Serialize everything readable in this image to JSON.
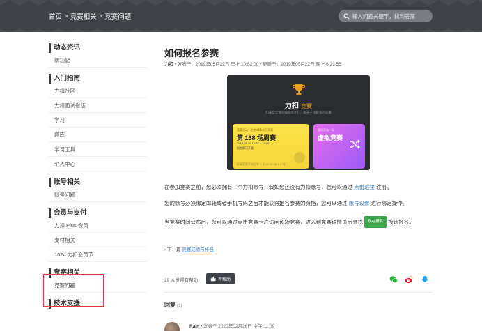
{
  "header": {
    "breadcrumbs": [
      "首页",
      "竞赛相关",
      "竞赛问题"
    ],
    "separator": ">",
    "search_placeholder": "输入问题关键字，找到答案"
  },
  "sidebar": {
    "sections": [
      {
        "title": "动态资讯",
        "items": [
          "新功能"
        ]
      },
      {
        "title": "入门指南",
        "items": [
          "力扣社区",
          "力扣面试省版",
          "学习",
          "题库",
          "学习工具",
          "个人中心"
        ]
      },
      {
        "title": "账号相关",
        "items": [
          "账号问题"
        ]
      },
      {
        "title": "会员与支付",
        "items": [
          "力扣 Plus 会员",
          "支付相关",
          "1024 力扣会员节"
        ]
      },
      {
        "title": "竞赛相关",
        "items": [
          "竞赛问题"
        ]
      },
      {
        "title": "技术支援",
        "items": []
      }
    ],
    "active_item": "竞赛问题",
    "highlight_color": "#e23a3a"
  },
  "article": {
    "title": "如何报名参赛",
    "author": "力扣",
    "meta": "• 发表于：2019年05月22日 早上 10:52:00 • 更新于：2019年05月22日 晚上 6:23:55",
    "banner": {
      "brand": "力扣",
      "brand_sub": "竞赛",
      "slogan": "和来自全球的编程高手们，展开一场紧张的竞赛",
      "card1_top": "竞赛活动 | 北京 5月26日 开赛",
      "card1_name": "第 138 场周赛",
      "card1_time": "2019-05-26  10:30 ~ 12:00",
      "card1_tag": "报名即可开赛",
      "card1_foot": "距离竞赛开始还有  3 天 10:32:48 1 小时",
      "card2_top": "随时开始一场",
      "card2_name": "虚拟竞赛",
      "card1_color": "#ffe24a",
      "card2_color": "#c862f2"
    },
    "p1_before": "在参加竞赛之前，您必须拥有一个力扣账号，假如您还没有力扣账号，您可以通过 ",
    "p1_link": "点击这里",
    "p1_after": " 注册。",
    "p2_before": "您的账号必须绑定邮箱或者手机号码之后才能获得报名参赛的资格，您可以通过 ",
    "p2_link": "账号设置",
    "p2_after": " 进行绑定操作。",
    "p3_before": "当竞赛时间公布后，您可以通过点击竞赛卡片访问该场竞赛，进入到竞赛详情页后寻找 ",
    "p3_button": "现在报名",
    "p3_after": " 按钮报名。",
    "next_prefix": "› 下一篇",
    "next_link": "竞赛成绩与排名",
    "helpful_text": "19 人觉得有帮助",
    "helpful_button": "有帮助",
    "link_color": "#3478c6"
  },
  "replies": {
    "title": "回复",
    "count": "(1)",
    "first_author": "Rain",
    "first_meta": "• 发表于 2020年02月26日 中午 11:09"
  },
  "icons": [
    "search-icon",
    "trophy-icon",
    "shuffle-icon",
    "thumbs-up-icon",
    "wechat-icon",
    "weibo-icon",
    "qq-icon"
  ]
}
